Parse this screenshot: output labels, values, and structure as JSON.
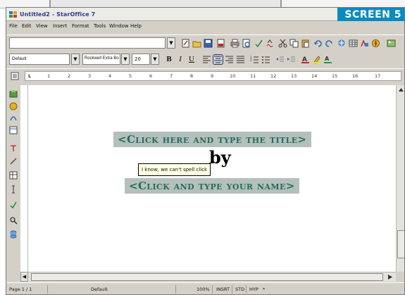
{
  "window": {
    "title": "Untitled2 - StarOffice 7",
    "badge": "SCREEN 5"
  },
  "menu": [
    "File",
    "Edit",
    "View",
    "Insert",
    "Format",
    "Tools",
    "Window",
    "Help"
  ],
  "function_bar": {
    "url_value": ""
  },
  "format_bar": {
    "style": "Default",
    "font": "Rockwell Extra Bo",
    "size": "20",
    "bold": "B",
    "italic": "I",
    "underline": "U"
  },
  "ruler": {
    "tab_marker": "L",
    "ticks": [
      "1",
      "2",
      "3",
      "4",
      "5",
      "6",
      "7",
      "8",
      "9",
      "10",
      "11",
      "12",
      "13",
      "14",
      "15",
      "16",
      "17"
    ]
  },
  "document": {
    "title_placeholder": "<Click here and type the title>",
    "by": "by",
    "tooltip": "I know, we can't spell click",
    "name_placeholder": "<Click and type your name>"
  },
  "status": {
    "page": "Page 1 / 1",
    "style": "Default",
    "zoom": "100%",
    "insert": "INSRT",
    "selection": "STD",
    "hyperlink": "HYP",
    "modified": "*"
  },
  "colors": {
    "title_text": "#2f3a8c",
    "badge_bg": "#0a8bbf",
    "field_bg": "#b5bfbb",
    "field_text": "#1f6e5e",
    "chrome": "#d4d0c8"
  }
}
